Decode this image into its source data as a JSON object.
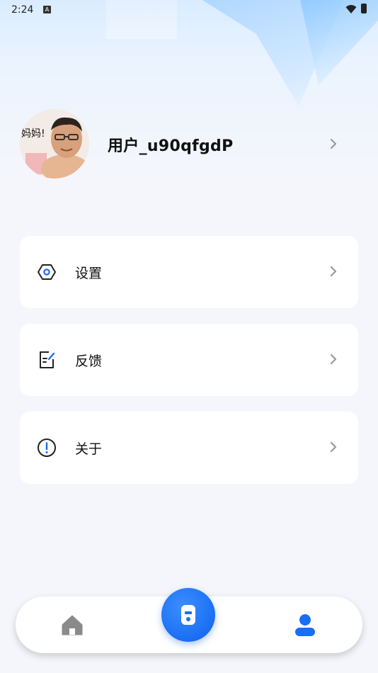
{
  "status_bar": {
    "time": "2:24",
    "notification_badge": "A"
  },
  "profile": {
    "username": "用户_u90qfgdP",
    "avatar_caption": "妈妈!"
  },
  "menu": [
    {
      "label": "设置",
      "icon": "settings-hexagon-icon"
    },
    {
      "label": "反馈",
      "icon": "feedback-edit-icon"
    },
    {
      "label": "关于",
      "icon": "about-info-icon"
    }
  ],
  "bottom_nav": {
    "items": [
      {
        "icon": "home-icon",
        "active": false
      },
      {
        "icon": "remote-control-icon",
        "active": true
      },
      {
        "icon": "profile-icon",
        "active": true
      }
    ]
  },
  "colors": {
    "accent": "#1a6ef3",
    "background": "#f4f6fb",
    "card": "#ffffff",
    "chevron": "#9a9a9a",
    "home_icon": "#8a8a8a"
  }
}
